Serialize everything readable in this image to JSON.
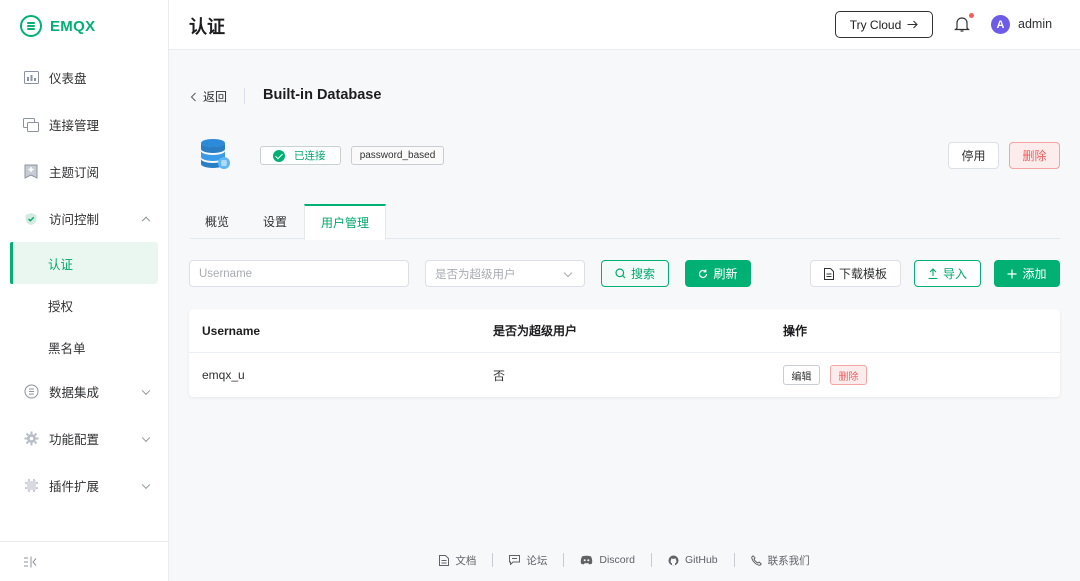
{
  "app": {
    "logo_text": "EMQX",
    "brand_color": "#00b173"
  },
  "header": {
    "title": "认证",
    "try_cloud_label": "Try Cloud",
    "user_avatar_letter": "A",
    "username": "admin"
  },
  "sidebar": {
    "items": [
      {
        "label": "仪表盘",
        "icon": "dashboard-icon"
      },
      {
        "label": "连接管理",
        "icon": "connections-icon"
      },
      {
        "label": "主题订阅",
        "icon": "subscriptions-icon"
      },
      {
        "label": "访问控制",
        "icon": "access-control-icon",
        "expanded": true
      },
      {
        "label": "认证",
        "sub": true,
        "active": true
      },
      {
        "label": "授权",
        "sub": true
      },
      {
        "label": "黑名单",
        "sub": true
      },
      {
        "label": "数据集成",
        "icon": "data-integration-icon"
      },
      {
        "label": "功能配置",
        "icon": "gear-icon"
      },
      {
        "label": "插件扩展",
        "icon": "plugin-icon"
      }
    ]
  },
  "detail": {
    "back_label": "返回",
    "title": "Built-in Database",
    "status": "已连接",
    "mechanism": "password_based",
    "disable_label": "停用",
    "delete_label": "删除"
  },
  "tabs": [
    {
      "label": "概览"
    },
    {
      "label": "设置"
    },
    {
      "label": "用户管理",
      "active": true
    }
  ],
  "toolbar": {
    "username_placeholder": "Username",
    "superuser_placeholder": "是否为超级用户",
    "search_label": "搜索",
    "refresh_label": "刷新",
    "template_label": "下载模板",
    "import_label": "导入",
    "add_label": "添加"
  },
  "table": {
    "columns": [
      "Username",
      "是否为超级用户",
      "操作"
    ],
    "rows": [
      {
        "username": "emqx_u",
        "is_superuser": "否",
        "edit_label": "编辑",
        "delete_label": "删除"
      }
    ]
  },
  "footer": {
    "links": [
      "文档",
      "论坛",
      "Discord",
      "GitHub",
      "联系我们"
    ]
  }
}
